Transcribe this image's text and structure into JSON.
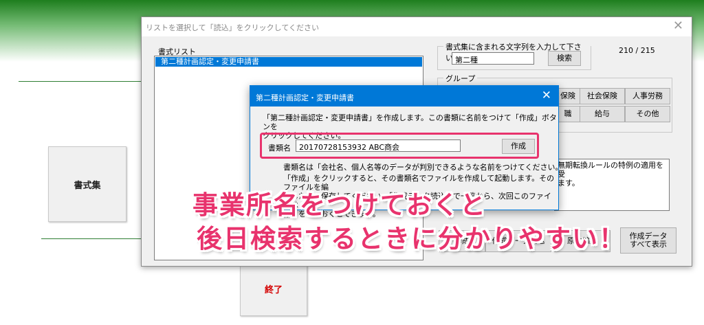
{
  "background": {
    "side_buttons": {
      "shoshikishu": "書式集",
      "shuryo": "終了"
    },
    "accent_green": "#1e7e1e"
  },
  "main_window": {
    "title": "リストを選択して「読込」をクリックしてください",
    "list_label": "書式リスト",
    "list_items": [
      "第二種計画認定・変更申請書"
    ],
    "search_group_label": "書式集に含まれる文字列を入力して下さい",
    "search_value": "第二種",
    "search_button": "検索",
    "count": "210  /  215",
    "group_label": "グループ",
    "group_buttons": [
      "保険",
      "社会保険",
      "人事労務",
      "職",
      "給与",
      "その他"
    ],
    "description_text": "無期転換ルールの特例の適用を受\nます。",
    "bottom_buttons": [
      "作成",
      "作成データ読込",
      "原本編集",
      "作成データ\nすべて表示"
    ]
  },
  "dialog": {
    "title": "第二種計画認定・変更申請書",
    "instruction": "「第二種計画認定・変更申請書」を作成します。この書類に名前をつけて「作成」ボタンを\nクリックしてください。",
    "doc_name_label": "書類名",
    "doc_name_value": "20170728153932  ABC商会",
    "create_button": "作成",
    "note1": "書類名は「会社名、個人名等のデータが判別できるような名前をつけてください。",
    "note2": "「作成」をクリックすると、その書類名でファイルを作成して起動します。そのファイルを編\n集した後、保存してください。「作成データ読込」で一覧から、次回このファイルは「保\n存」をしておくとできます。",
    "highlight_color": "#e8336d"
  },
  "overlay_caption": {
    "line1": "事業所名をつけておくと",
    "line2": "後日検索するときに分かりやすい！"
  }
}
